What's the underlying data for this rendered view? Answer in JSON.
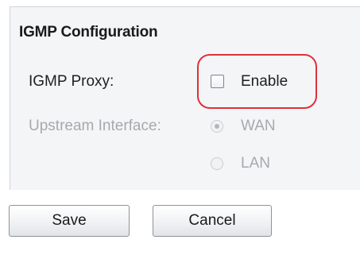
{
  "section": {
    "title": "IGMP Configuration"
  },
  "igmp_proxy": {
    "label": "IGMP Proxy:",
    "checkbox_label": "Enable",
    "checked": false
  },
  "upstream_interface": {
    "label": "Upstream Interface:",
    "disabled": true,
    "options": [
      {
        "label": "WAN",
        "selected": true
      },
      {
        "label": "LAN",
        "selected": false
      }
    ]
  },
  "actions": {
    "save_label": "Save",
    "cancel_label": "Cancel"
  },
  "colors": {
    "highlight": "#e0303a",
    "disabled_text": "#a7a9ac",
    "panel_background": "#f4f5f7"
  }
}
